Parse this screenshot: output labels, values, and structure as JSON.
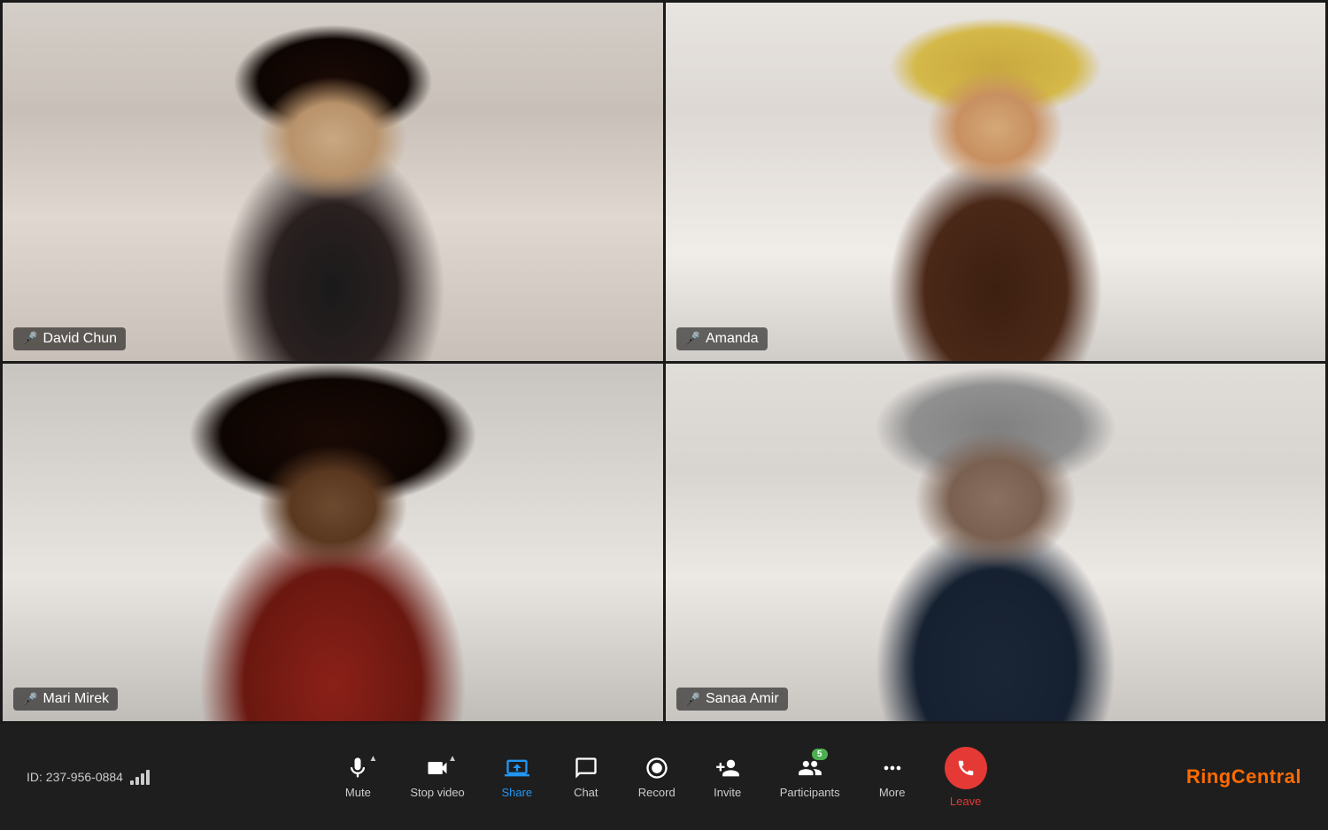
{
  "meeting": {
    "id": "ID: 237-956-0884",
    "signal_bars": [
      4,
      8,
      12,
      16,
      18
    ]
  },
  "participants": [
    {
      "id": "david-chun",
      "name": "David Chun",
      "mic_status": "active",
      "active_speaker": true,
      "position": "top-left"
    },
    {
      "id": "amanda",
      "name": "Amanda",
      "mic_status": "muted",
      "active_speaker": false,
      "position": "top-right"
    },
    {
      "id": "mari-mirek",
      "name": "Mari Mirek",
      "mic_status": "active",
      "active_speaker": false,
      "position": "bottom-left"
    },
    {
      "id": "sanaa-amir",
      "name": "Sanaa Amir",
      "mic_status": "active",
      "active_speaker": false,
      "position": "bottom-right"
    }
  ],
  "toolbar": {
    "buttons": [
      {
        "id": "mute",
        "label": "Mute",
        "icon": "microphone",
        "has_chevron": true,
        "active": false
      },
      {
        "id": "stop-video",
        "label": "Stop video",
        "icon": "video-camera",
        "has_chevron": true,
        "active": false
      },
      {
        "id": "share",
        "label": "Share",
        "icon": "share-screen",
        "has_chevron": false,
        "active": true
      },
      {
        "id": "chat",
        "label": "Chat",
        "icon": "chat-bubble",
        "has_chevron": false,
        "active": false
      },
      {
        "id": "record",
        "label": "Record",
        "icon": "record-circle",
        "has_chevron": false,
        "active": false
      },
      {
        "id": "invite",
        "label": "Invite",
        "icon": "person-plus",
        "has_chevron": false,
        "active": false
      },
      {
        "id": "participants",
        "label": "Participants",
        "icon": "people",
        "has_chevron": false,
        "active": false,
        "count": "5"
      },
      {
        "id": "more",
        "label": "More",
        "icon": "three-dots",
        "has_chevron": false,
        "active": false
      },
      {
        "id": "leave",
        "label": "Leave",
        "icon": "phone-down",
        "has_chevron": false,
        "active": false
      }
    ],
    "logo": "RingCentral"
  }
}
